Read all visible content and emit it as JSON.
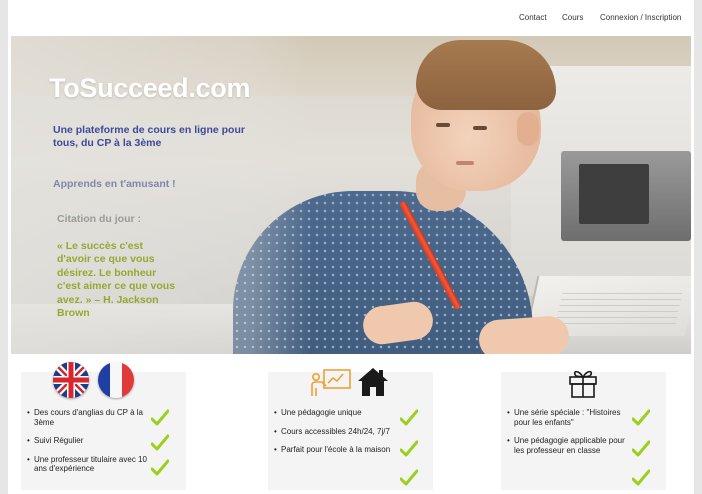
{
  "nav": {
    "contact": "Contact",
    "courses": "Cours",
    "auth": "Connexion / Inscription"
  },
  "hero": {
    "title": "ToSucceed.com",
    "subtitle": "Une plateforme de cours en ligne pour tous, du CP à la 3ème",
    "motto": "Apprends en t'amusant !",
    "quote_label": "Citation du jour :",
    "quote": "« Le succès c'est d'avoir ce que vous désirez. Le bonheur c'est aimer ce que vous avez. » – H. Jackson Brown"
  },
  "cards": [
    {
      "icons": [
        "uk-flag-icon",
        "france-flag-icon"
      ],
      "items": [
        "Des cours d'anglias du CP à la 3ème",
        "Suivi Régulier",
        "Une professeur titulaire avec 10 ans d'expérience"
      ]
    },
    {
      "icons": [
        "teacher-board-icon",
        "house-icon"
      ],
      "items": [
        "Une pédagogie unique",
        "Cours accessibles 24h/24, 7j/7",
        "Parfait pour l'école à la maison"
      ]
    },
    {
      "icons": [
        "gift-icon"
      ],
      "items": [
        "Une série spéciale : \"Histoires pour les enfants\"",
        "Une pédagogie applicable pour les professeur en classe"
      ]
    }
  ],
  "colors": {
    "subtitle": "#3c4a9a",
    "motto": "#8085ad",
    "quote": "#96a830",
    "check": "#9bcf1b",
    "icon_orange": "#f0a033"
  }
}
